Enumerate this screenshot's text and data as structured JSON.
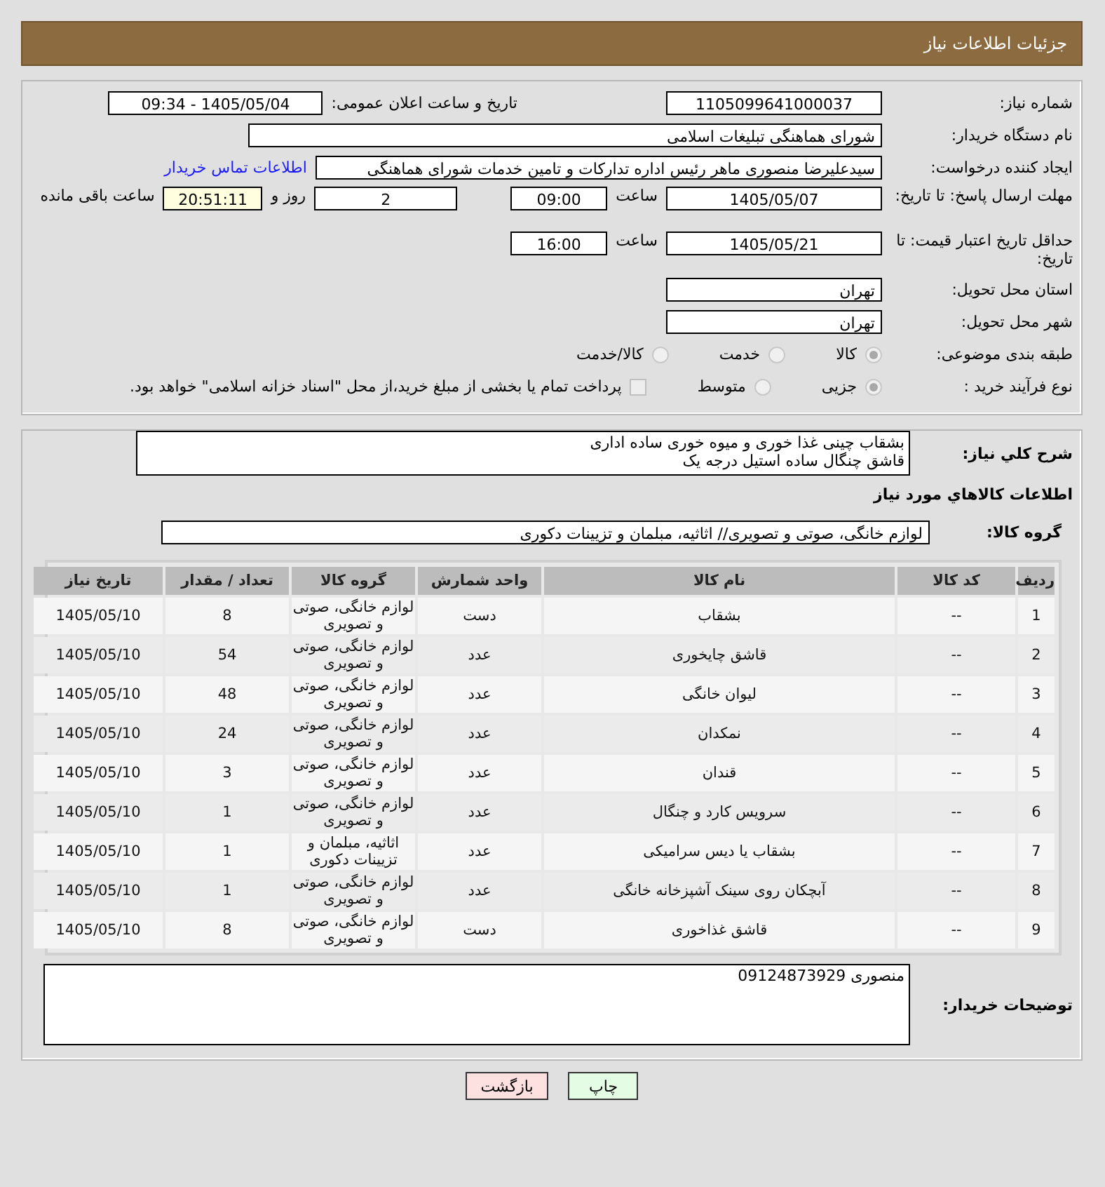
{
  "header": {
    "title": "جزئیات اطلاعات نیاز"
  },
  "need_number": {
    "label": "شماره نیاز:",
    "value": "1105099641000037"
  },
  "announce": {
    "label": "تاریخ و ساعت اعلان عمومی:",
    "value": "1405/05/04 - 09:34"
  },
  "buyer_org": {
    "label": "نام دستگاه خریدار:",
    "value": "شورای هماهنگی تبلیغات اسلامی"
  },
  "requester": {
    "label": "ایجاد کننده درخواست:",
    "value": "سیدعلیرضا منصوری ماهر رئیس اداره تدارکات و تامین خدمات  شورای هماهنگی",
    "link": "اطلاعات تماس خریدار"
  },
  "response_deadline": {
    "label": "مهلت ارسال پاسخ: تا تاریخ:",
    "date": "1405/05/07",
    "time_label": "ساعت",
    "time": "09:00",
    "days": "2",
    "days_label": "روز و",
    "remaining": "20:51:11",
    "remaining_label": "ساعت باقی مانده"
  },
  "price_validity": {
    "label": "حداقل تاریخ اعتبار قیمت: تا تاریخ:",
    "date": "1405/05/21",
    "time_label": "ساعت",
    "time": "16:00"
  },
  "province": {
    "label": "استان محل تحویل:",
    "value": "تهران"
  },
  "city": {
    "label": "شهر محل تحویل:",
    "value": "تهران"
  },
  "category": {
    "label": "طبقه بندی موضوعی:",
    "options": [
      {
        "label": "کالا",
        "selected": true
      },
      {
        "label": "خدمت",
        "selected": false
      },
      {
        "label": "کالا/خدمت",
        "selected": false
      }
    ]
  },
  "purchase_process": {
    "label": "نوع فرآیند خرید :",
    "options": [
      {
        "label": "جزیی",
        "selected": true
      },
      {
        "label": "متوسط",
        "selected": false
      }
    ],
    "payment_note": {
      "checked": false,
      "text": "پرداخت تمام یا بخشی از مبلغ خرید،از محل \"اسناد خزانه اسلامی\" خواهد بود."
    }
  },
  "description": {
    "label": "شرح کلي نیاز:",
    "value": "بشقاب چینی غذا خوری و میوه خوری ساده اداری\nقاشق چنگال ساده استیل درجه یک"
  },
  "goods_title": "اطلاعات کالاهاي مورد نیاز",
  "goods_group": {
    "label": "گروه کالا:",
    "value": "لوازم خانگی، صوتی و تصویری// اثاثیه، مبلمان و تزیینات دکوری"
  },
  "table": {
    "columns": [
      "ردیف",
      "کد کالا",
      "نام کالا",
      "واحد شمارش",
      "گروه کالا",
      "تعداد / مقدار",
      "تاریخ نیاز"
    ],
    "rows": [
      [
        "1",
        "--",
        "بشقاب",
        "دست",
        "لوازم خانگی، صوتی و تصویری",
        "8",
        "1405/05/10"
      ],
      [
        "2",
        "--",
        "قاشق چایخوری",
        "عدد",
        "لوازم خانگی، صوتی و تصویری",
        "54",
        "1405/05/10"
      ],
      [
        "3",
        "--",
        "لیوان خانگی",
        "عدد",
        "لوازم خانگی، صوتی و تصویری",
        "48",
        "1405/05/10"
      ],
      [
        "4",
        "--",
        "نمکدان",
        "عدد",
        "لوازم خانگی، صوتی و تصویری",
        "24",
        "1405/05/10"
      ],
      [
        "5",
        "--",
        "قندان",
        "عدد",
        "لوازم خانگی، صوتی و تصویری",
        "3",
        "1405/05/10"
      ],
      [
        "6",
        "--",
        "سرویس کارد و چنگال",
        "عدد",
        "لوازم خانگی، صوتی و تصویری",
        "1",
        "1405/05/10"
      ],
      [
        "7",
        "--",
        "بشقاب یا دیس سرامیکی",
        "عدد",
        "اثاثیه، مبلمان و تزیینات دکوری",
        "1",
        "1405/05/10"
      ],
      [
        "8",
        "--",
        "آبچکان روی سینک آشپزخانه خانگی",
        "عدد",
        "لوازم خانگی، صوتی و تصویری",
        "1",
        "1405/05/10"
      ],
      [
        "9",
        "--",
        "قاشق غذاخوری",
        "دست",
        "لوازم خانگی، صوتی و تصویری",
        "8",
        "1405/05/10"
      ]
    ]
  },
  "buyer_notes": {
    "label": "توضیحات خریدار:",
    "value": "منصوری 09124873929"
  },
  "buttons": [
    {
      "label": "چاپ",
      "kind": "print"
    },
    {
      "label": "بازگشت",
      "kind": "back"
    }
  ]
}
